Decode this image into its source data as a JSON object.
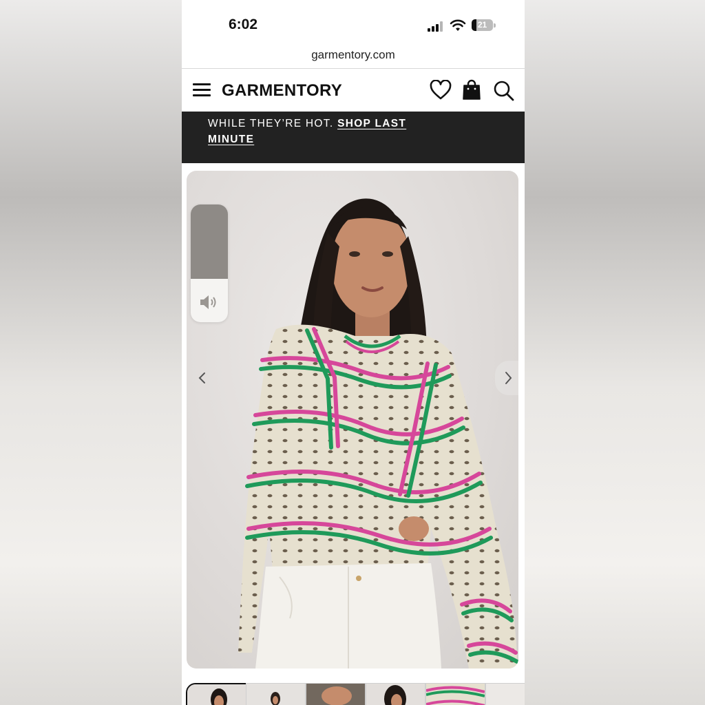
{
  "status_bar": {
    "time": "6:02",
    "battery_level": "21"
  },
  "browser": {
    "url": "garmentory.com"
  },
  "site_header": {
    "logo": "GARMENTORY",
    "icons": [
      "menu-icon",
      "heart-icon",
      "bag-icon",
      "search-icon"
    ]
  },
  "promo": {
    "text": "WHILE THEY’RE HOT.",
    "link": "SHOP LAST MINUTE"
  },
  "gallery": {
    "volume_level": 0.37,
    "thumbnail_count": 6,
    "active_thumbnail": 1
  },
  "colors": {
    "banner_bg": "#222222",
    "stripe_pink": "#d6479a",
    "stripe_green": "#1f9a5a"
  }
}
